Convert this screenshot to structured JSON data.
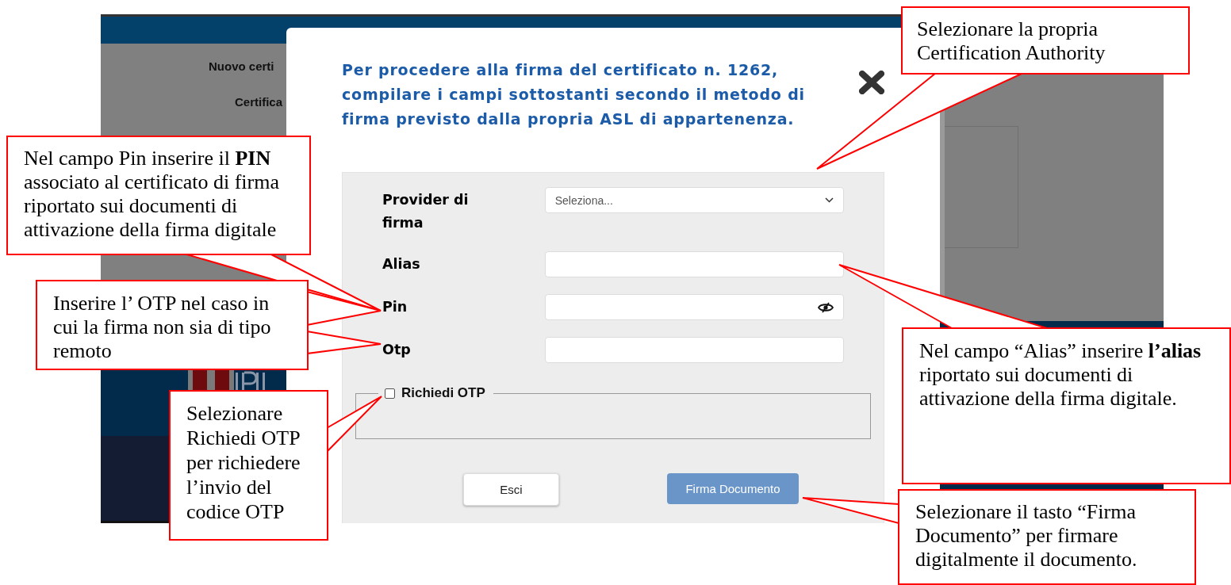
{
  "background": {
    "heading": "Nuovo certi",
    "label": "Certifica"
  },
  "dialog": {
    "message": "Per procedere alla firma del certificato n. 1262, compilare i campi sottostanti secondo il metodo di firma previsto dalla propria ASL di appartenenza.",
    "fields": [
      {
        "kind": "select",
        "label": "Provider di firma",
        "placeholder": "Seleziona..."
      },
      {
        "kind": "text",
        "label": "Alias"
      },
      {
        "kind": "password",
        "label": "Pin"
      },
      {
        "kind": "text",
        "label": "Otp"
      }
    ],
    "request_otp": {
      "label": "Richiedi OTP",
      "checked": false
    },
    "buttons": [
      {
        "label": "Esci",
        "kind": "secondary"
      },
      {
        "label": "Firma Documento",
        "kind": "primary"
      }
    ]
  },
  "callouts": [
    {
      "text": "Selezionare la propria Certification Authority"
    },
    {
      "text": "Nel campo Pin inserire il **PIN** associato al certificato di firma riportato sui documenti di attivazione della firma digitale"
    },
    {
      "text": "Inserire l’ OTP nel caso in cui la firma non sia di tipo remoto"
    },
    {
      "text": "Nel campo “Alias” inserire **l’alias** riportato sui documenti di attivazione della firma digitale."
    },
    {
      "text": "Selezionare Richiedi OTP per richiedere l’invio del codice OTP"
    },
    {
      "text": "Selezionare il tasto “Firma Documento” per firmare digitalmente il documento."
    }
  ]
}
